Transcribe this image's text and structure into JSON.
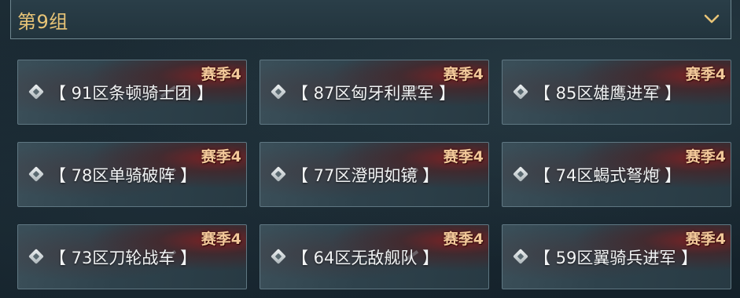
{
  "header": {
    "group_label": "第9组",
    "expand_icon": "chevron-down-icon"
  },
  "colors": {
    "title_gold": "#e8c477",
    "season_badge": "#f2c99a",
    "card_border": "#5f7782",
    "name_text": "#f1f3f4"
  },
  "servers": [
    {
      "name": "【 91区条顿骑士团 】",
      "season": "赛季4",
      "icon": "diamond-icon"
    },
    {
      "name": "【 87区匈牙利黑军 】",
      "season": "赛季4",
      "icon": "diamond-icon"
    },
    {
      "name": "【 85区雄鹰进军 】",
      "season": "赛季4",
      "icon": "diamond-icon"
    },
    {
      "name": "【 78区单骑破阵 】",
      "season": "赛季4",
      "icon": "diamond-icon"
    },
    {
      "name": "【 77区澄明如镜 】",
      "season": "赛季4",
      "icon": "diamond-icon"
    },
    {
      "name": "【 74区蝎式弩炮 】",
      "season": "赛季4",
      "icon": "diamond-icon"
    },
    {
      "name": "【 73区刀轮战车 】",
      "season": "赛季4",
      "icon": "diamond-icon"
    },
    {
      "name": "【 64区无敌舰队 】",
      "season": "赛季4",
      "icon": "diamond-icon"
    },
    {
      "name": "【 59区翼骑兵进军 】",
      "season": "赛季4",
      "icon": "diamond-icon"
    }
  ]
}
